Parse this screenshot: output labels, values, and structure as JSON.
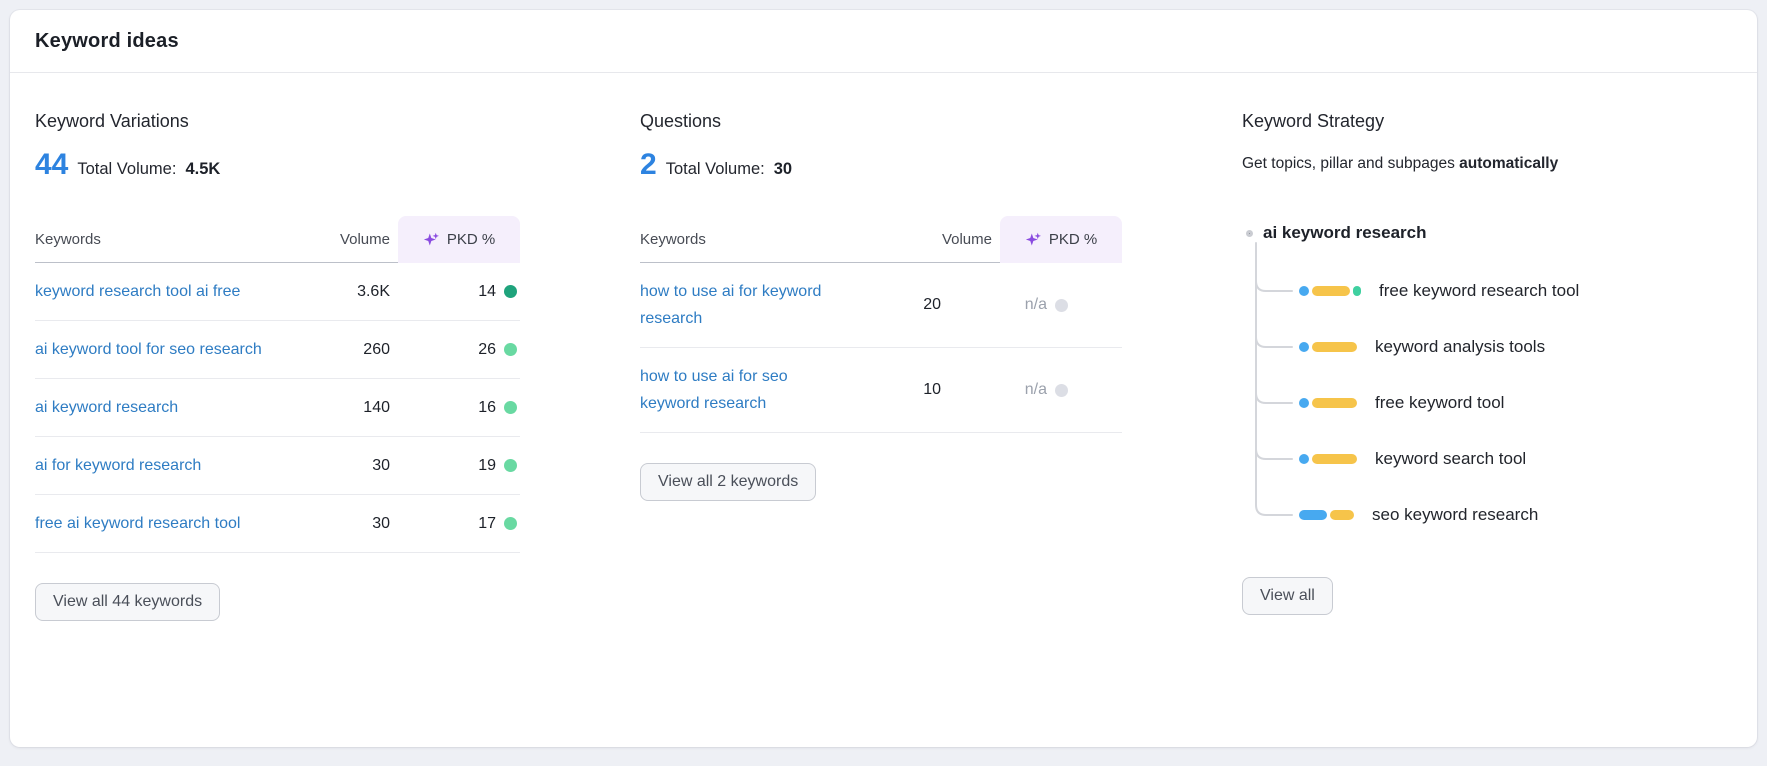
{
  "card": {
    "title": "Keyword ideas"
  },
  "variations": {
    "title": "Keyword Variations",
    "count": "44",
    "total_label": "Total Volume:",
    "total_value": "4.5K",
    "headers": {
      "keywords": "Keywords",
      "volume": "Volume",
      "pkd": "PKD %"
    },
    "rows": [
      {
        "keyword": "keyword research tool ai free",
        "volume": "3.6K",
        "pkd": "14",
        "dot": "#1fa37c"
      },
      {
        "keyword": "ai keyword tool for seo research",
        "volume": "260",
        "pkd": "26",
        "dot": "#69d9a2"
      },
      {
        "keyword": "ai keyword research",
        "volume": "140",
        "pkd": "16",
        "dot": "#69d9a2"
      },
      {
        "keyword": "ai for keyword research",
        "volume": "30",
        "pkd": "19",
        "dot": "#69d9a2"
      },
      {
        "keyword": "free ai keyword research tool",
        "volume": "30",
        "pkd": "17",
        "dot": "#69d9a2"
      }
    ],
    "view_all": "View all 44 keywords"
  },
  "questions": {
    "title": "Questions",
    "count": "2",
    "total_label": "Total Volume:",
    "total_value": "30",
    "headers": {
      "keywords": "Keywords",
      "volume": "Volume",
      "pkd": "PKD %"
    },
    "rows": [
      {
        "keyword": "how to use ai for keyword research",
        "volume": "20",
        "pkd": "n/a",
        "dot": "#dcdee5"
      },
      {
        "keyword": "how to use ai for seo keyword research",
        "volume": "10",
        "pkd": "n/a",
        "dot": "#dcdee5"
      }
    ],
    "view_all": "View all 2 keywords"
  },
  "strategy": {
    "title": "Keyword Strategy",
    "subtitle_text": "Get topics, pillar and subpages ",
    "subtitle_bold": "automatically",
    "root_label": "ai keyword research",
    "children": [
      {
        "label": "free keyword research tool",
        "bar": [
          "blue",
          "yellow",
          "teal"
        ]
      },
      {
        "label": "keyword analysis tools",
        "bar": [
          "blue",
          "yellow"
        ]
      },
      {
        "label": "free keyword tool",
        "bar": [
          "blue",
          "yellow"
        ]
      },
      {
        "label": "keyword search tool",
        "bar": [
          "blue",
          "yellow"
        ]
      },
      {
        "label": "seo keyword research",
        "bar": [
          "blue-wide",
          "yellow"
        ]
      }
    ],
    "view_all": "View all"
  },
  "colors": {
    "accent_blue": "#2d83e0",
    "link_blue": "#2e7cc3",
    "pkd_green_dark": "#1fa37c",
    "pkd_green": "#69d9a2",
    "na_dot": "#dcdee5",
    "pkd_purple": "#8a4be0",
    "pkd_header_bg": "#f5effc",
    "bar_blue": "#47a9f0",
    "bar_yellow": "#f6c44a",
    "bar_teal": "#3fd0a0"
  }
}
